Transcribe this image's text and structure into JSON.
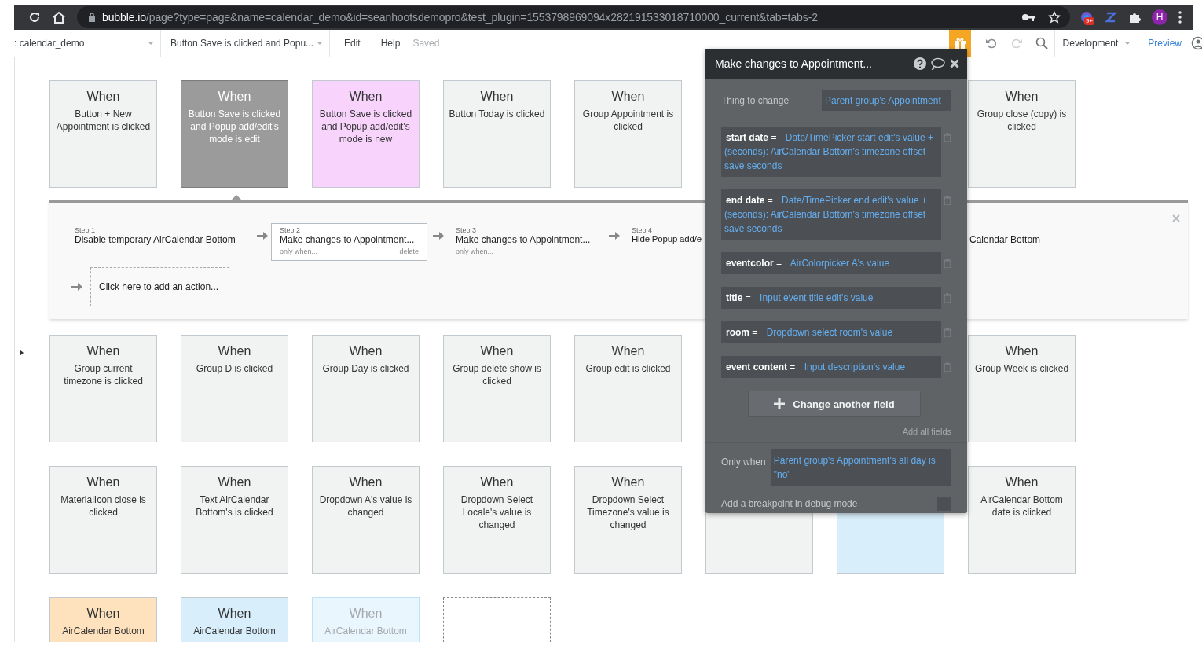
{
  "browser": {
    "url_host": "bubble.io",
    "url_path": "/page?type=page&name=calendar_demo&id=seanhootsdemopro&test_plugin=1553798969094x282191533018710000_current&tab=tabs-2",
    "extension_badge": "9+",
    "profile_initial": "H"
  },
  "toolbar": {
    "page": ": calendar_demo",
    "event": "Button Save is clicked and Popu...",
    "menu": [
      "Edit",
      "Help"
    ],
    "save_status": "Saved",
    "mode": "Development",
    "preview": "Preview"
  },
  "event_rows": [
    {
      "marked": false,
      "cards": [
        {
          "kind": "event",
          "heading": "When",
          "text": "Button + New Appointment is clicked",
          "color": "#f1f2f2",
          "selected": false,
          "disabled": false
        },
        {
          "kind": "event",
          "heading": "When",
          "text": "Button Save is clicked and Popup add/edit's mode is edit",
          "color": "#9b9b9b",
          "selected": true,
          "disabled": false
        },
        {
          "kind": "event",
          "heading": "When",
          "text": "Button Save is clicked and Popup add/edit's mode is new",
          "color": "#f8d4fd",
          "selected": false,
          "disabled": false
        },
        {
          "kind": "event",
          "heading": "When",
          "text": "Button Today is clicked",
          "color": "#f1f2f2",
          "selected": false,
          "disabled": false
        },
        {
          "kind": "event",
          "heading": "When",
          "text": "Group Appointment is clicked",
          "color": "#f1f2f2",
          "selected": false,
          "disabled": false
        }
      ],
      "end_cards": [
        {
          "kind": "event",
          "heading": "When",
          "text": "Group close (copy) is clicked",
          "color": "#f1f2f2",
          "selected": false,
          "disabled": false
        }
      ]
    },
    {
      "marked": true,
      "cards": [
        {
          "kind": "event",
          "heading": "When",
          "text": "Group current timezone is clicked",
          "color": "#f1f2f2",
          "selected": false,
          "disabled": false
        },
        {
          "kind": "event",
          "heading": "When",
          "text": "Group D is clicked",
          "color": "#f1f2f2",
          "selected": false,
          "disabled": false
        },
        {
          "kind": "event",
          "heading": "When",
          "text": "Group Day is clicked",
          "color": "#f1f2f2",
          "selected": false,
          "disabled": false
        },
        {
          "kind": "event",
          "heading": "When",
          "text": "Group delete show is clicked",
          "color": "#f1f2f2",
          "selected": false,
          "disabled": false
        },
        {
          "kind": "event",
          "heading": "When",
          "text": "Group edit is clicked",
          "color": "#f1f2f2",
          "selected": false,
          "disabled": false
        }
      ],
      "end_cards": [
        {
          "kind": "event",
          "heading": "When",
          "text": "Group Week is clicked",
          "color": "#f1f2f2",
          "selected": false,
          "disabled": false
        }
      ]
    },
    {
      "marked": false,
      "cards": [
        {
          "kind": "event",
          "heading": "When",
          "text": "MaterialIcon close is clicked",
          "color": "#f1f2f2",
          "selected": false,
          "disabled": false
        },
        {
          "kind": "event",
          "heading": "When",
          "text": "Text AirCalendar Bottom's is clicked",
          "color": "#f1f2f2",
          "selected": false,
          "disabled": false
        },
        {
          "kind": "event",
          "heading": "When",
          "text": "Dropdown A's value is changed",
          "color": "#f1f2f2",
          "selected": false,
          "disabled": false
        },
        {
          "kind": "event",
          "heading": "When",
          "text": "Dropdown Select Locale's value is changed",
          "color": "#f1f2f2",
          "selected": false,
          "disabled": false
        },
        {
          "kind": "event",
          "heading": "When",
          "text": "Dropdown Select Timezone's value is changed",
          "color": "#f1f2f2",
          "selected": false,
          "disabled": false
        },
        {
          "kind": "event",
          "color": "#f1f2f2",
          "selected": false,
          "disabled": false
        },
        {
          "kind": "event",
          "color": "#d8eefb",
          "selected": false,
          "disabled": false
        },
        {
          "kind": "event",
          "heading": "When",
          "text": "AirCalendar Bottom date is clicked",
          "color": "#f1f2f2",
          "selected": false,
          "disabled": false
        }
      ]
    },
    {
      "marked": false,
      "cards": [
        {
          "kind": "event",
          "heading": "When",
          "text": "AirCalendar Bottom",
          "color": "#fde2bd",
          "selected": false,
          "disabled": false
        },
        {
          "kind": "event",
          "heading": "When",
          "text": "AirCalendar Bottom",
          "color": "#d8eefb",
          "selected": false,
          "disabled": false
        },
        {
          "kind": "event",
          "heading": "When",
          "text": "AirCalendar Bottom",
          "color": "#e9f6fe",
          "selected": false,
          "disabled": true
        },
        {
          "kind": "add"
        }
      ]
    }
  ],
  "action_panel": {
    "steps": [
      {
        "label": "Step 1",
        "title": "Disable temporary AirCalendar Bottom",
        "selected": false
      },
      {
        "label": "Step 2",
        "title": "Make changes to Appointment...",
        "condition": "only when...",
        "delete": "delete",
        "selected": true
      },
      {
        "label": "Step 3",
        "title": "Make changes to Appointment...",
        "condition": "only when...",
        "selected": false
      },
      {
        "label": "Step 4",
        "title": "Hide Popup add/e",
        "selected": false
      }
    ],
    "step_5_title_fragment": "Calendar Bottom",
    "add_action": "Click here to add an action..."
  },
  "popup": {
    "title": "Make changes to Appointment...",
    "thing_label": "Thing to change",
    "thing_value": "Parent group's Appointment",
    "fields": [
      {
        "name": "start date",
        "operator": "=",
        "value": "Date/TimePicker start edit's value + (seconds): AirCalendar Bottom's timezone offset save seconds"
      },
      {
        "name": "end date",
        "operator": "=",
        "value": "Date/TimePicker end edit's value + (seconds): AirCalendar Bottom's timezone offset save seconds"
      },
      {
        "name": "eventcolor",
        "operator": "=",
        "value": "AirColorpicker A's value"
      },
      {
        "name": "title",
        "operator": "=",
        "value": "Input event title edit's value"
      },
      {
        "name": "room",
        "operator": "=",
        "value": "Dropdown select room's value"
      },
      {
        "name": "event content",
        "operator": "=",
        "value": "Input description's value"
      }
    ],
    "add_field": "Change another field",
    "add_all": "Add all fields",
    "only_when_label": "Only when",
    "only_when_value": "Parent group's Appointment's all day is \"no\"",
    "breakpoint_label": "Add a breakpoint in debug mode",
    "breakpoint_checked": false
  }
}
